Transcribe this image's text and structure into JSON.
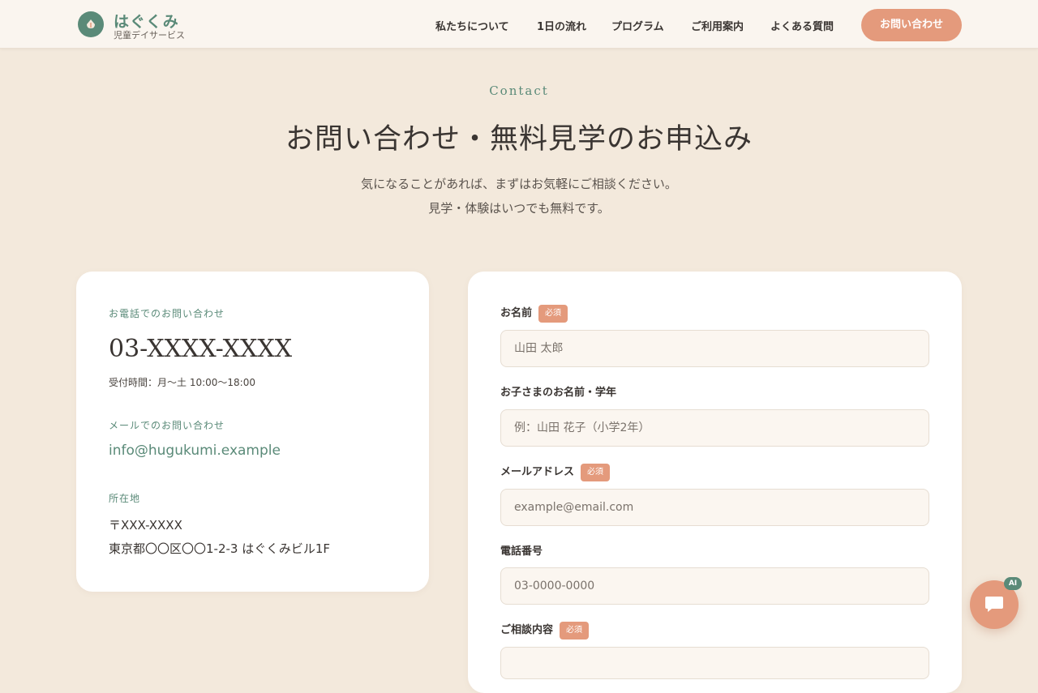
{
  "header": {
    "logo_name": "はぐくみ",
    "logo_sub": "児童デイサービス",
    "nav": [
      "私たちについて",
      "1日の流れ",
      "プログラム",
      "ご利用案内",
      "よくある質問"
    ],
    "cta_label": "お問い合わせ"
  },
  "hero": {
    "eyebrow": "Contact",
    "title": "お問い合わせ・無料見学のお申込み",
    "lead_1": "気になることがあれば、まずはお気軽にご相談ください。",
    "lead_2": "見学・体験はいつでも無料です。"
  },
  "info": {
    "phone_label": "お電話でのお問い合わせ",
    "phone": "03-XXXX-XXXX",
    "hours": "受付時間：月〜土 10:00〜18:00",
    "email_label": "メールでのお問い合わせ",
    "email": "info@hugukumi.example",
    "address_label": "所在地",
    "postal": "〒XXX-XXXX",
    "address": "東京都〇〇区〇〇1-2-3 はぐくみビル1F"
  },
  "form": {
    "required_label": "必須",
    "name_label": "お名前",
    "name_placeholder": "山田 太郎",
    "child_label": "お子さまのお名前・学年",
    "child_placeholder": "例：山田 花子（小学2年）",
    "email_label": "メールアドレス",
    "email_placeholder": "example@email.com",
    "tel_label": "電話番号",
    "tel_placeholder": "03-0000-0000",
    "inquiry_label": "ご相談内容"
  },
  "chat": {
    "badge": "AI"
  },
  "colors": {
    "accent": "#e49a7c",
    "brand": "#5a8a78",
    "background": "#f3e9dc"
  },
  "icons": {
    "logo": "leaf-icon",
    "chat": "chat-bubble-icon"
  }
}
